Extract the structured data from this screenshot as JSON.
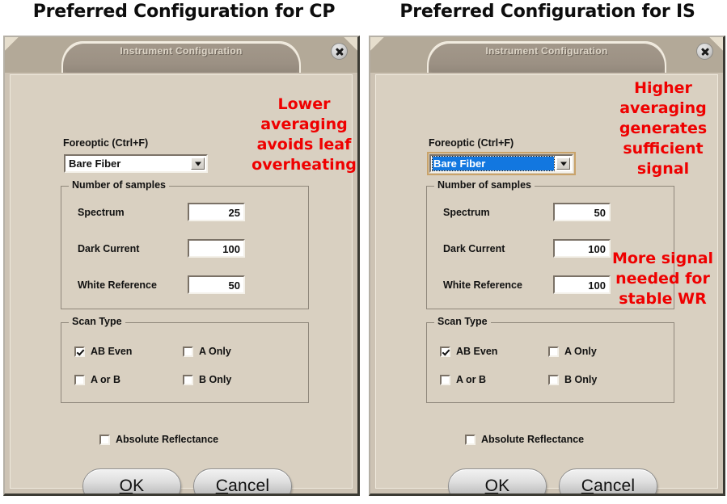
{
  "figure": {
    "title_left": "Preferred Configuration for CP",
    "title_right": "Preferred Configuration for IS"
  },
  "dialog": {
    "window_title": "Instrument Configuration",
    "close_icon": "close-icon"
  },
  "labels": {
    "foreoptic": "Foreoptic (Ctrl+F)",
    "number_of_samples": "Number of samples",
    "spectrum": "Spectrum",
    "dark_current": "Dark Current",
    "white_reference": "White Reference",
    "scan_type": "Scan Type",
    "absolute_reflectance": "Absolute Reflectance"
  },
  "scan_type_options": {
    "ab_even": "AB Even",
    "a_only": "A Only",
    "a_or_b": "A or B",
    "b_only": "B Only"
  },
  "buttons": {
    "ok": "OK",
    "ok_accel": "O",
    "ok_rest": "K",
    "cancel": "Cancel",
    "cancel_accel": "C",
    "cancel_rest": "ancel"
  },
  "panel_cp": {
    "foreoptic_value": "Bare Fiber",
    "foreoptic_focused": false,
    "spectrum_value": "25",
    "dark_current_value": "100",
    "white_reference_value": "50",
    "ab_even_checked": true,
    "a_only_checked": false,
    "a_or_b_checked": false,
    "b_only_checked": false,
    "absolute_reflectance_checked": false,
    "annotation_1": "Lower\naveraging\navoids leaf\noverheating"
  },
  "panel_is": {
    "foreoptic_value": "Bare Fiber",
    "foreoptic_focused": true,
    "spectrum_value": "50",
    "dark_current_value": "100",
    "white_reference_value": "100",
    "ab_even_checked": true,
    "a_only_checked": false,
    "a_or_b_checked": false,
    "b_only_checked": false,
    "absolute_reflectance_checked": false,
    "annotation_1": "Higher\naveraging\ngenerates\nsufficient\nsignal",
    "annotation_2": "More signal\nneeded for\nstable WR"
  },
  "colors": {
    "annotation_red": "#ef0000",
    "dialog_face": "#d9d0c1",
    "titlebar": "#b3a998",
    "selection_blue": "#1277e0"
  }
}
